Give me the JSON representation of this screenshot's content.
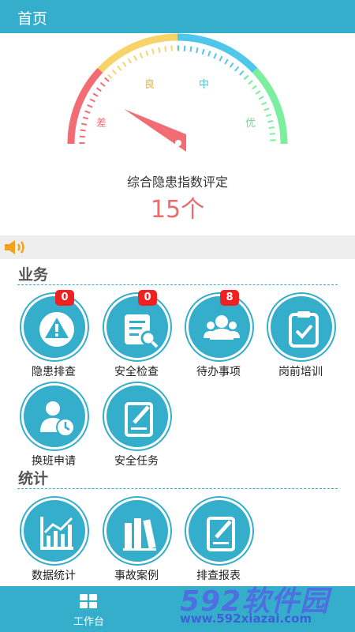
{
  "header": {
    "title": "首页"
  },
  "gauge": {
    "labels": {
      "poor": "差",
      "fair": "良",
      "medium": "中",
      "excellent": "优"
    },
    "caption": "综合隐患指数评定",
    "score": "15个",
    "colors": {
      "poor": "#f26d73",
      "fair": "#f7d46a",
      "medium": "#4ec7ea",
      "excellent": "#7cef9e"
    }
  },
  "business": {
    "title": "业务",
    "items": [
      {
        "label": "隐患排查",
        "badge": "0",
        "icon": "warning-icon"
      },
      {
        "label": "安全检查",
        "badge": "0",
        "icon": "checklist-icon"
      },
      {
        "label": "待办事项",
        "badge": "8",
        "icon": "people-icon"
      },
      {
        "label": "岗前培训",
        "icon": "clipboard-check-icon"
      },
      {
        "label": "换班申请",
        "icon": "person-clock-icon"
      },
      {
        "label": "安全任务",
        "icon": "edit-document-icon"
      }
    ]
  },
  "stats": {
    "title": "统计",
    "items": [
      {
        "label": "数据统计",
        "icon": "chart-icon"
      },
      {
        "label": "事故案例",
        "icon": "books-icon"
      },
      {
        "label": "排查报表",
        "icon": "report-icon"
      }
    ]
  },
  "tabbar": {
    "tabs": [
      {
        "label": "工作台",
        "icon": "grid-icon"
      }
    ]
  },
  "watermark": {
    "big": "592软件园",
    "small": "www.592xiazai.com"
  }
}
